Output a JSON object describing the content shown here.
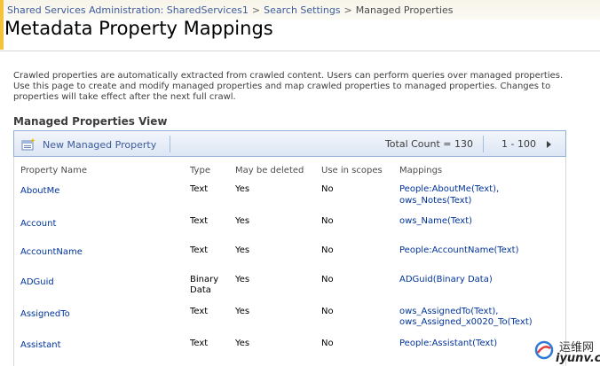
{
  "breadcrumb": {
    "items": [
      "Shared Services Administration: SharedServices1",
      "Search Settings",
      "Managed Properties"
    ],
    "separator": ">"
  },
  "page_title": "Metadata Property Mappings",
  "description": "Crawled properties are automatically extracted from crawled content. Users can perform queries over managed properties. Use this page to create and modify managed properties and map crawled properties to managed properties. Changes to properties will take effect after the next full crawl.",
  "view_title": "Managed Properties View",
  "toolbar": {
    "new_label": "New Managed Property",
    "total_count_label": "Total Count = 130",
    "paging_label": "1 - 100"
  },
  "columns": [
    "Property Name",
    "Type",
    "May be deleted",
    "Use in scopes",
    "Mappings"
  ],
  "rows": [
    {
      "name": "AboutMe",
      "type": [
        "Text"
      ],
      "deletable": "Yes",
      "scopes": "No",
      "mappings": [
        "People:AboutMe(Text),",
        "ows_Notes(Text)"
      ]
    },
    {
      "name": "Account",
      "type": [
        "Text"
      ],
      "deletable": "Yes",
      "scopes": "No",
      "mappings": [
        "ows_Name(Text)"
      ]
    },
    {
      "name": "AccountName",
      "type": [
        "Text"
      ],
      "deletable": "Yes",
      "scopes": "No",
      "mappings": [
        "People:AccountName(Text)"
      ]
    },
    {
      "name": "ADGuid",
      "type": [
        "Binary",
        "Data"
      ],
      "deletable": "Yes",
      "scopes": "No",
      "mappings": [
        "ADGuid(Binary Data)"
      ]
    },
    {
      "name": "AssignedTo",
      "type": [
        "Text"
      ],
      "deletable": "Yes",
      "scopes": "No",
      "mappings": [
        "ows_AssignedTo(Text),",
        "ows_Assigned_x0020_To(Text)"
      ]
    },
    {
      "name": "Assistant",
      "type": [
        "Text"
      ],
      "deletable": "Yes",
      "scopes": "No",
      "mappings": [
        "People:Assistant(Text)"
      ]
    }
  ],
  "watermark": {
    "line1": "运维网",
    "line2": "iyunv.com"
  },
  "colors": {
    "accent_gold": "#f3c33b",
    "link": "#003399",
    "toolbar_border": "#91b1da"
  },
  "icons": {
    "new_item": "new-item-icon",
    "next_page": "next-page-arrow-icon"
  }
}
